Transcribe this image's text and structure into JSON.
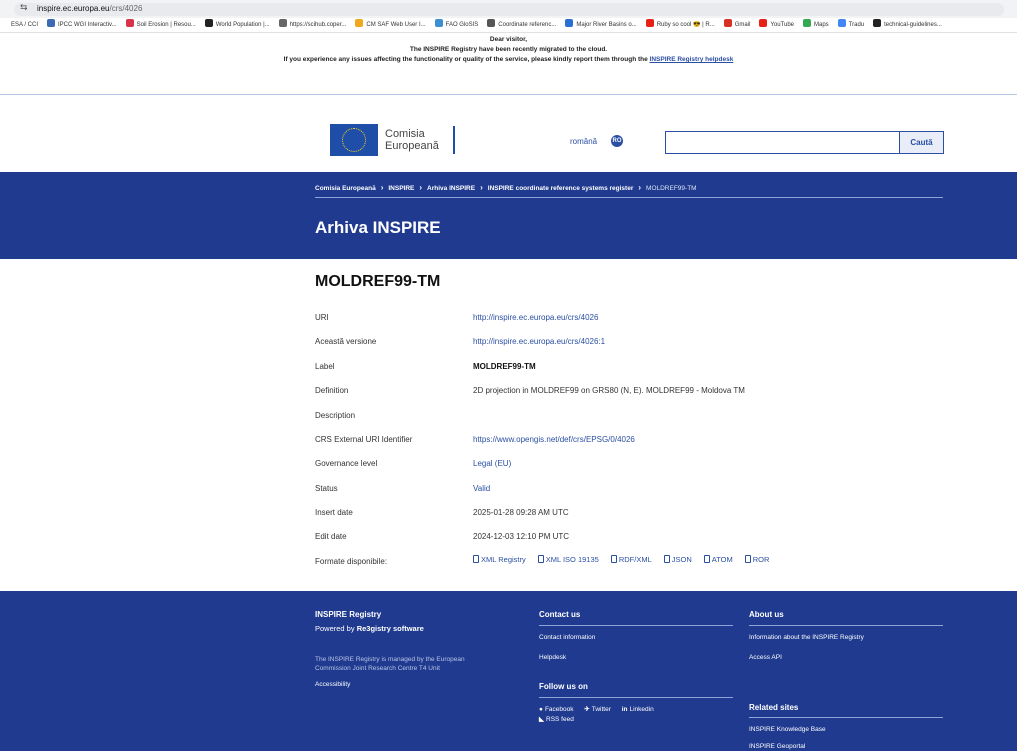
{
  "browser": {
    "url_host": "inspire.ec.europa.eu",
    "url_path": "/crs/4026",
    "bookmarks": [
      {
        "label": "ESA / CCI",
        "color": "#ffffff"
      },
      {
        "label": "IPCC WGI Interactiv...",
        "color": "#3b6bb5"
      },
      {
        "label": "Soil Erosion | Resou...",
        "color": "#d8334a"
      },
      {
        "label": "World Population |...",
        "color": "#222222"
      },
      {
        "label": "https://scihub.coper...",
        "color": "#666666"
      },
      {
        "label": "CM SAF Web User I...",
        "color": "#f2a81d"
      },
      {
        "label": "FAO GloSIS",
        "color": "#3b8fd3"
      },
      {
        "label": "Coordinate referenc...",
        "color": "#555555"
      },
      {
        "label": "Major River Basins o...",
        "color": "#2a6fd6"
      },
      {
        "label": "Ruby so cool 😎 | R...",
        "color": "#e62117"
      },
      {
        "label": "Gmail",
        "color": "#d93025"
      },
      {
        "label": "YouTube",
        "color": "#e62117"
      },
      {
        "label": "Maps",
        "color": "#34a853"
      },
      {
        "label": "Tradu",
        "color": "#4285f4"
      },
      {
        "label": "technical-guidelines...",
        "color": "#222222"
      }
    ]
  },
  "notice": {
    "line1": "Dear visitor,",
    "line2": "The INSPIRE Registry have been recently migrated to the cloud.",
    "line3_prefix": "If you experience any issues affecting the functionality or quality of the service, please kindly report them through the ",
    "line3_link": "INSPIRE Registry helpdesk"
  },
  "header": {
    "logo_line1": "Comisia",
    "logo_line2": "Europeană",
    "language": "română",
    "language_code": "RO",
    "search_placeholder": "",
    "search_button": "Caută"
  },
  "breadcrumb": [
    "Comisia Europeană",
    "INSPIRE",
    "Arhiva INSPIRE",
    "INSPIRE coordinate reference systems register",
    "MOLDREF99-TM"
  ],
  "band_title": "Arhiva INSPIRE",
  "page_title": "MOLDREF99-TM",
  "rows": [
    {
      "label": "URI",
      "value": "http://inspire.ec.europa.eu/crs/4026",
      "style": "link"
    },
    {
      "label": "Această versione",
      "value": "http://inspire.ec.europa.eu/crs/4026:1",
      "style": "link"
    },
    {
      "label": "Label",
      "value": "MOLDREF99-TM",
      "style": "bold"
    },
    {
      "label": "Definition",
      "value": "2D projection in MOLDREF99 on GRS80 (N, E). MOLDREF99 - Moldova TM",
      "style": "plain"
    },
    {
      "label": "Description",
      "value": "",
      "style": "plain"
    },
    {
      "label": "CRS External URI Identifier",
      "value": "https://www.opengis.net/def/crs/EPSG/0/4026",
      "style": "link"
    },
    {
      "label": "Governance level",
      "value": "Legal (EU)",
      "style": "link"
    },
    {
      "label": "Status",
      "value": "Valid",
      "style": "link"
    },
    {
      "label": "Insert date",
      "value": "2025-01-28 09:28 AM UTC",
      "style": "plain"
    },
    {
      "label": "Edit date",
      "value": "2024-12-03 12:10 PM UTC",
      "style": "plain"
    }
  ],
  "formats_label": "Formate disponibile:",
  "formats": [
    "XML Registry",
    "XML ISO 19135",
    "RDF/XML",
    "JSON",
    "ATOM",
    "ROR"
  ],
  "footer": {
    "registry_title": "INSPIRE Registry",
    "powered_prefix": "Powered by ",
    "powered_name": "Re3gistry software",
    "managed_text_1": "The INSPIRE Registry is managed by the European",
    "managed_text_2": "Commission Joint Research Centre T4 Unit",
    "accessibility": "Accessibility",
    "contact_title": "Contact us",
    "contact_info": "Contact information",
    "helpdesk": "Helpdesk",
    "follow_title": "Follow us on",
    "facebook": "Facebook",
    "twitter": "Twitter",
    "linkedin": "Linkedin",
    "rss": "RSS feed",
    "about_title": "About us",
    "about_info": "Information about the INSPIRE Registry",
    "access_api": "Access API",
    "related_title": "Related sites",
    "knowledge_base": "INSPIRE Knowledge Base",
    "geoportal": "INSPIRE Geoportal"
  }
}
